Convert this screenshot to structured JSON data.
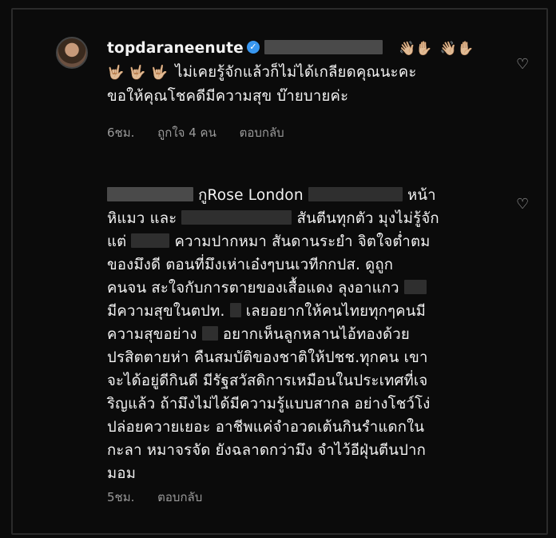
{
  "comment1": {
    "username": "topdaraneenute",
    "line1_text": "ไม่เคยรู้จักแล้วก็ไม่ได้เกลียดคุณนะคะ",
    "line2_text": "ขอให้คุณโชคดีมีความสุข บ๊ายบายค่ะ",
    "wave_emoji": "👋🏼✋🏼",
    "rock_emoji": "🤟🏼",
    "time": "6ชม.",
    "likes": "ถูกใจ 4 คน",
    "reply": "ตอบกลับ"
  },
  "comment2": {
    "lines": {
      "l1a": "กูRose London",
      "l1b": "หน้า",
      "l2a": "หิแมว และ",
      "l2b": "สันตีนทุกตัว มุงไม่รู้จัก",
      "l3a": "แต่",
      "l3b": "ความปากหมา สันดานระยำ จิตใจต่ำตม",
      "l4": "ของมึงดี ตอนที่มึงเห่าเอ๋งๆบนเวทีกกปส. ดูถูก",
      "l5": "คนจน สะใจกับการตายของเสื้อแดง ลุงอาแกว",
      "l6a": "มีความสุขในตปท.",
      "l6b": "เลยอยากให้คนไทยทุกๆคนมี",
      "l7a": "ความสุขอย่าง",
      "l7b": "อยากเห็นลูกหลานไอ้ทองด้วย",
      "l8": "ปรสิตตายห่า คืนสมบัติของชาติให้ปชช.ทุกคน เขา",
      "l9": "จะได้อยู่ดีกินดี มีรัฐสวัสดิการเหมือนในประเทศที่เจ",
      "l10": "ริญแล้ว ถ้ามึงไม่ได้มีความรู้แบบสากล อย่างโชว์โง่",
      "l11": "ปล่อยควายเยอะ อาชีพแค่จำอวดเต้นกินรำแดกใน",
      "l12": "กะลา หมาจรจัด ยังฉลาดกว่ามึง จำไว้อีฝุ่นตีนปาก",
      "l13": "มอม"
    },
    "time": "5ชม.",
    "reply": "ตอบกลับ"
  },
  "icons": {
    "heart": "heart-icon",
    "verified": "verified-badge-icon"
  }
}
